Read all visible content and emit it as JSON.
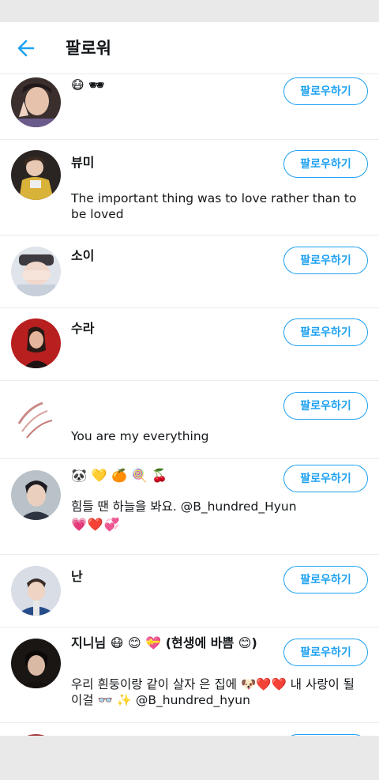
{
  "header": {
    "title": "팔로워"
  },
  "follow_label": "팔로우하기",
  "users": [
    {
      "name": "😷 🕶",
      "bio": ""
    },
    {
      "name": "뷰미",
      "bio": "The important thing was to love rather than to be loved"
    },
    {
      "name": "소이",
      "bio": ""
    },
    {
      "name": "수라",
      "bio": ""
    },
    {
      "name": "",
      "bio": "You are my everything"
    },
    {
      "name": "🐼 💛 🍊 🍭 🍒",
      "bio": "힘들 땐 하늘을 봐요. @B_hundred_Hyun",
      "hearts": "💗❤️💞"
    },
    {
      "name": "난",
      "bio": ""
    },
    {
      "name": "지니님 😷 😊 💝 (현생에 바쁨 😊)",
      "bio": "우리 흰둥이랑 같이 살자 은 집에 🐶❤️❤️ 내 사랑이 될 이걸 👓 ✨ @B_hundred_hyun"
    }
  ],
  "colors": {
    "accent": "#1da1f2",
    "text": "#14171a",
    "divider": "#e6ecf0"
  }
}
